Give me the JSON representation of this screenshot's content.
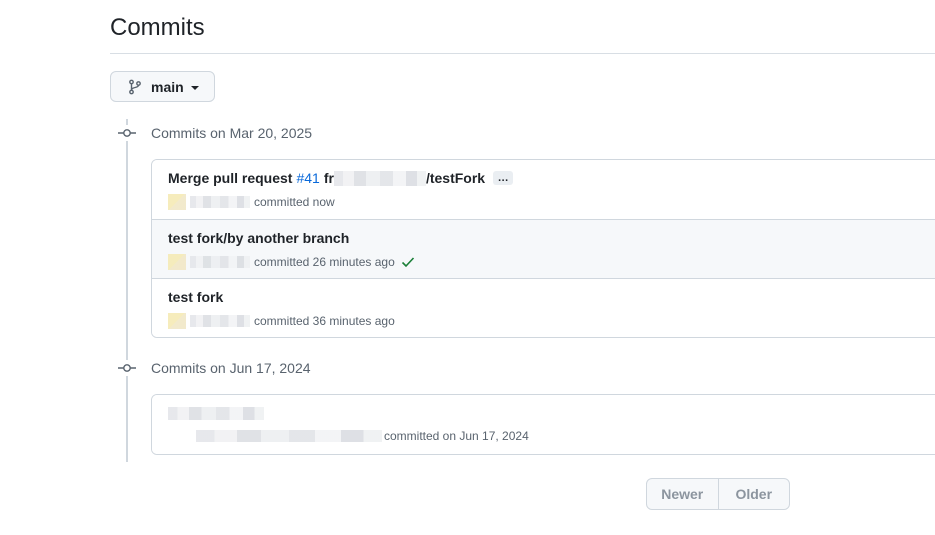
{
  "page": {
    "title": "Commits"
  },
  "branch": {
    "name": "main"
  },
  "groups": [
    {
      "heading": "Commits on Mar 20, 2025",
      "commits": [
        {
          "message_prefix": "Merge pull request",
          "pr_link": "#41",
          "message_mid": "fr",
          "message_suffix": "/testFork",
          "meta": "committed now",
          "verified": false
        },
        {
          "message": "test fork/by another branch",
          "meta": "committed 26 minutes ago",
          "verified": true
        },
        {
          "message": "test fork",
          "meta": "committed 36 minutes ago",
          "verified": false
        }
      ]
    },
    {
      "heading": "Commits on Jun 17, 2024",
      "commits": [
        {
          "message": "",
          "meta": "committed on Jun 17, 2024",
          "verified": false
        }
      ]
    }
  ],
  "pagination": {
    "newer": "Newer",
    "older": "Older"
  },
  "icons": {
    "branch": "git-branch-icon",
    "commit": "git-commit-icon",
    "check": "check-icon",
    "ellipsis": "ellipsis-icon"
  },
  "colors": {
    "link": "#0969da",
    "success": "#1a7f37",
    "muted": "#59636e",
    "border": "#d0d7de"
  }
}
